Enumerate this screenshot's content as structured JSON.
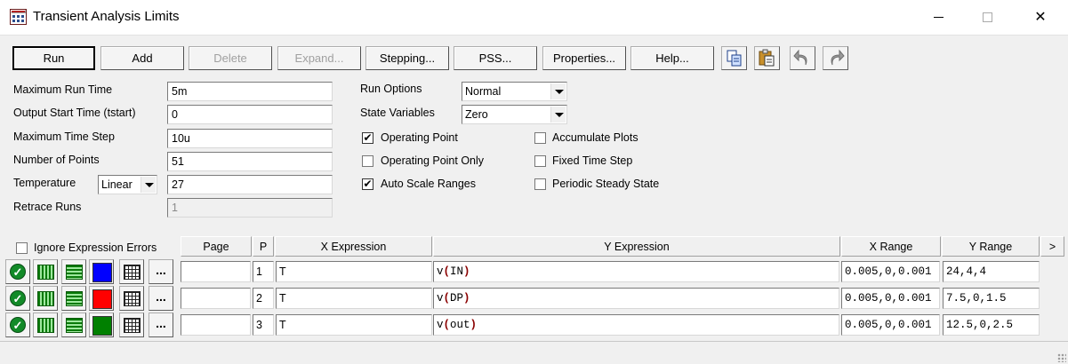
{
  "window": {
    "title": "Transient Analysis Limits",
    "minimize_glyph": "",
    "close_glyph": "✕"
  },
  "toolbar": {
    "run": "Run",
    "add": "Add",
    "delete": "Delete",
    "expand": "Expand...",
    "stepping": "Stepping...",
    "pss": "PSS...",
    "properties": "Properties...",
    "help": "Help...",
    "icons": [
      "copy-icon",
      "paste-icon",
      "undo-icon",
      "redo-icon"
    ]
  },
  "limits": {
    "max_run_time_label": "Maximum Run Time",
    "max_run_time": "5m",
    "output_start_label": "Output Start Time (tstart)",
    "output_start": "0",
    "max_time_step_label": "Maximum Time Step",
    "max_time_step": "10u",
    "num_points_label": "Number of Points",
    "num_points": "51",
    "temperature_label": "Temperature",
    "temperature_mode": "Linear",
    "temperature": "27",
    "retrace_runs_label": "Retrace Runs",
    "retrace_runs": "1"
  },
  "options": {
    "run_options_label": "Run Options",
    "run_options": "Normal",
    "state_variables_label": "State Variables",
    "state_variables": "Zero",
    "checks_left": [
      {
        "label": "Operating Point",
        "checked": true
      },
      {
        "label": "Operating Point Only",
        "checked": false
      },
      {
        "label": "Auto Scale Ranges",
        "checked": true
      }
    ],
    "checks_right": [
      {
        "label": "Accumulate Plots",
        "checked": false
      },
      {
        "label": "Fixed Time Step",
        "checked": false
      },
      {
        "label": "Periodic Steady State",
        "checked": false
      }
    ]
  },
  "grid": {
    "ignore_errors_label": "Ignore Expression Errors",
    "headers": {
      "page": "Page",
      "p": "P",
      "x_expression": "X Expression",
      "y_expression": "Y Expression",
      "x_range": "X Range",
      "y_range": "Y Range",
      "more": ">"
    },
    "rows": [
      {
        "page": "",
        "p": "1",
        "x_expr": "T",
        "y_fn": "v",
        "y_arg": "IN",
        "x_range": "0.005,0,0.001",
        "y_range": "24,4,4",
        "color": "#0000ff"
      },
      {
        "page": "",
        "p": "2",
        "x_expr": "T",
        "y_fn": "v",
        "y_arg": "DP",
        "x_range": "0.005,0,0.001",
        "y_range": "7.5,0,1.5",
        "color": "#ff0000"
      },
      {
        "page": "",
        "p": "3",
        "x_expr": "T",
        "y_fn": "v",
        "y_arg": "out",
        "x_range": "0.005,0,0.001",
        "y_range": "12.5,0,2.5",
        "color": "#008000"
      }
    ],
    "row_icons": [
      "check-ok-icon",
      "vertical-grid-lines-icon",
      "horizontal-grid-lines-icon",
      "color-swatch",
      "plot-grid-icon",
      "ellipsis-button"
    ],
    "dots_label": "..."
  },
  "paren_open": "(",
  "paren_close": ")"
}
